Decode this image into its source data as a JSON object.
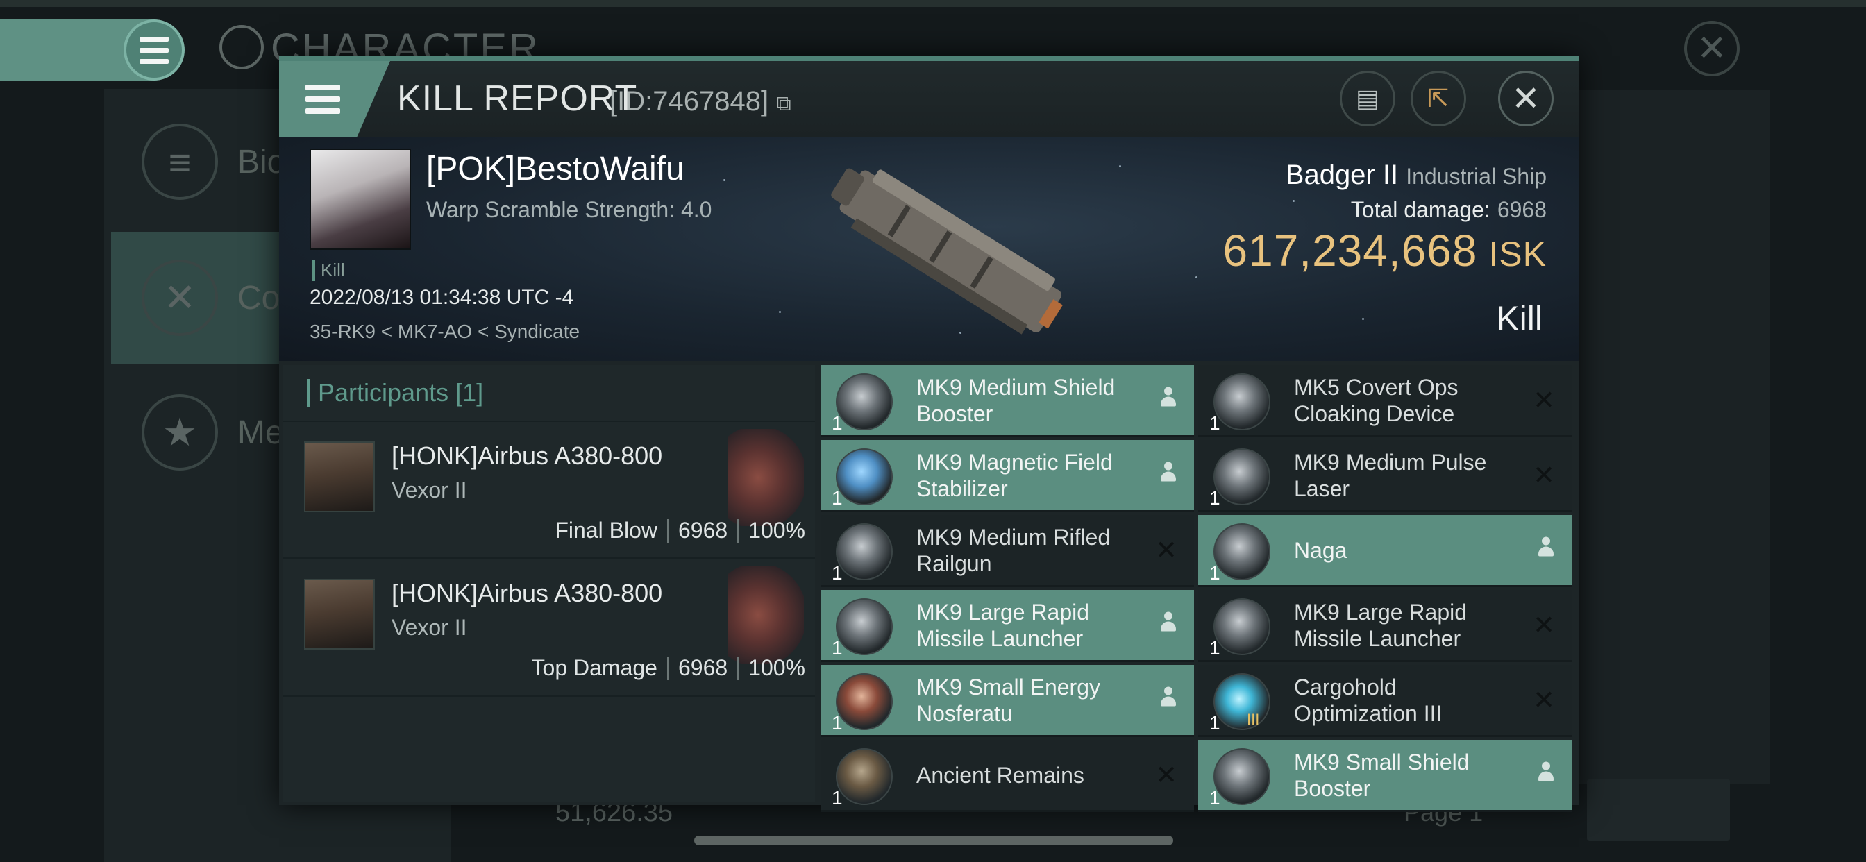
{
  "background": {
    "title": "CHARACTER",
    "side_items": [
      {
        "label": "Bio",
        "icon": "menu-lines-icon"
      },
      {
        "label": "Co",
        "icon": "crossed-swords-icon"
      },
      {
        "label": "Me",
        "icon": "star-shield-icon"
      }
    ],
    "bottom_value": "51,626.35",
    "page_label": "Page 1"
  },
  "dialog": {
    "title": "KILL REPORT",
    "id": "[ID:7467848]",
    "victim": {
      "name": "[POK]BestoWaifu",
      "scram": "Warp Scramble Strength: 4.0",
      "tag": "Kill",
      "datetime": "2022/08/13 01:34:38 UTC -4",
      "location": "35-RK9 < MK7-AO < Syndicate"
    },
    "ship": {
      "name": "Badger II",
      "class": "Industrial Ship",
      "total_damage_label": "Total damage:",
      "total_damage": "6968",
      "isk_value": "617,234,668",
      "isk_unit": "ISK",
      "result": "Kill"
    },
    "participants": {
      "title": "Participants",
      "count": "[1]",
      "attackers": [
        {
          "name": "[HONK]Airbus A380-800",
          "ship": "Vexor II",
          "role": "Final Blow",
          "damage": "6968",
          "percent": "100%"
        },
        {
          "name": "[HONK]Airbus A380-800",
          "ship": "Vexor II",
          "role": "Top Damage",
          "damage": "6968",
          "percent": "100%"
        }
      ]
    },
    "modules": [
      {
        "name": "MK9 Medium Shield Booster",
        "qty": "1",
        "state": "dropped"
      },
      {
        "name": "MK5 Covert Ops Cloaking Device",
        "qty": "1",
        "state": "destroyed"
      },
      {
        "name": "MK9 Magnetic Field Stabilizer",
        "qty": "1",
        "state": "dropped"
      },
      {
        "name": "MK9 Medium Pulse Laser",
        "qty": "1",
        "state": "destroyed"
      },
      {
        "name": "MK9 Medium Rifled Railgun",
        "qty": "1",
        "state": "destroyed"
      },
      {
        "name": "Naga",
        "qty": "1",
        "state": "dropped"
      },
      {
        "name": "MK9 Large Rapid Missile Launcher",
        "qty": "1",
        "state": "dropped"
      },
      {
        "name": "MK9 Large Rapid Missile Launcher",
        "qty": "1",
        "state": "destroyed"
      },
      {
        "name": "MK9 Small Energy Nosferatu",
        "qty": "1",
        "state": "dropped"
      },
      {
        "name": "Cargohold Optimization III",
        "qty": "1",
        "state": "destroyed",
        "tier": "III"
      },
      {
        "name": "Ancient Remains",
        "qty": "1",
        "state": "destroyed"
      },
      {
        "name": "MK9 Small Shield Booster",
        "qty": "1",
        "state": "dropped"
      }
    ]
  },
  "colors": {
    "accent": "#5b8e80",
    "isk": "#e8c27e",
    "background": "#141a1c"
  }
}
